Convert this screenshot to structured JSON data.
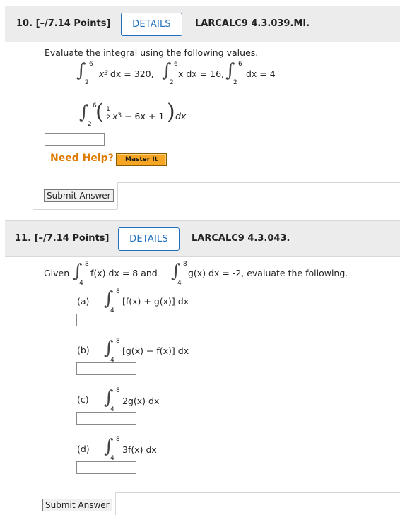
{
  "q10": {
    "number": "10.",
    "points": "[–/7.14 Points]",
    "details_label": "DETAILS",
    "code": "LARCALC9 4.3.039.MI.",
    "prompt": "Evaluate the integral using the following values.",
    "given": {
      "i1": {
        "upper": "6",
        "lower": "2",
        "integrand": "x",
        "power": "3",
        "rest": " dx = 320,"
      },
      "i2": {
        "upper": "6",
        "lower": "2",
        "integrand": "x dx = 16,",
        "rest": ""
      },
      "i3": {
        "upper": "6",
        "lower": "2",
        "integrand": "dx = 4",
        "rest": ""
      }
    },
    "target": {
      "upper": "6",
      "lower": "2",
      "frac_num": "1",
      "frac_den": "2",
      "var": "x",
      "power": "3",
      "rest": " − 6x + 1",
      "dx": "dx"
    },
    "answer_value": "",
    "need_help": "Need Help?",
    "master_it": "Master It",
    "submit": "Submit Answer"
  },
  "q11": {
    "number": "11.",
    "points": "[–/7.14 Points]",
    "details_label": "DETAILS",
    "code": "LARCALC9 4.3.043.",
    "given_word": "Given",
    "g1": {
      "upper": "8",
      "lower": "4",
      "text": "f(x) dx = 8 and"
    },
    "g2": {
      "upper": "8",
      "lower": "4",
      "text": "g(x) dx = -2, evaluate the following."
    },
    "parts": [
      {
        "label": "(a)",
        "upper": "8",
        "lower": "4",
        "expr": "[f(x) + g(x)] dx",
        "answer": ""
      },
      {
        "label": "(b)",
        "upper": "8",
        "lower": "4",
        "expr": "[g(x) − f(x)] dx",
        "answer": ""
      },
      {
        "label": "(c)",
        "upper": "8",
        "lower": "4",
        "expr": "2g(x) dx",
        "answer": ""
      },
      {
        "label": "(d)",
        "upper": "8",
        "lower": "4",
        "expr": "3f(x) dx",
        "answer": ""
      }
    ],
    "submit": "Submit Answer"
  },
  "colors": {
    "details_blue": "#1f6fbf",
    "need_help_orange": "#e07b00",
    "master_it_orange": "#f6a623",
    "header_gray": "#ececec"
  },
  "icons": {
    "integral": "∫"
  }
}
